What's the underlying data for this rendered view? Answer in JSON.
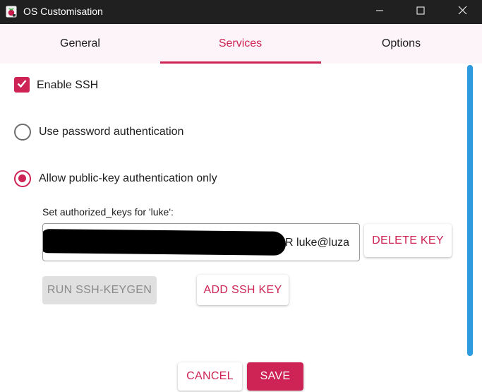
{
  "window": {
    "title": "OS Customisation",
    "accent_color": "#cd2355",
    "titlebar_color": "#202020"
  },
  "tabs": [
    {
      "label": "General",
      "active": false
    },
    {
      "label": "Services",
      "active": true
    },
    {
      "label": "Options",
      "active": false
    }
  ],
  "ssh": {
    "enable_label": "Enable SSH",
    "enable_checked": true,
    "password_auth_label": "Use password authentication",
    "password_auth_selected": false,
    "pubkey_auth_label": "Allow public-key authentication only",
    "pubkey_auth_selected": true,
    "authorized_keys_label": "Set authorized_keys for 'luke':",
    "authorized_key_visible_value": "XR luke@luza",
    "delete_key_label": "DELETE KEY",
    "run_keygen_label": "RUN SSH-KEYGEN",
    "add_key_label": "ADD SSH KEY"
  },
  "footer": {
    "cancel_label": "CANCEL",
    "save_label": "SAVE"
  },
  "icons": {
    "app": "raspberry-pi-icon",
    "minimize": "minimize-icon",
    "maximize": "maximize-icon",
    "close": "close-icon",
    "checkmark": "checkmark-icon"
  }
}
